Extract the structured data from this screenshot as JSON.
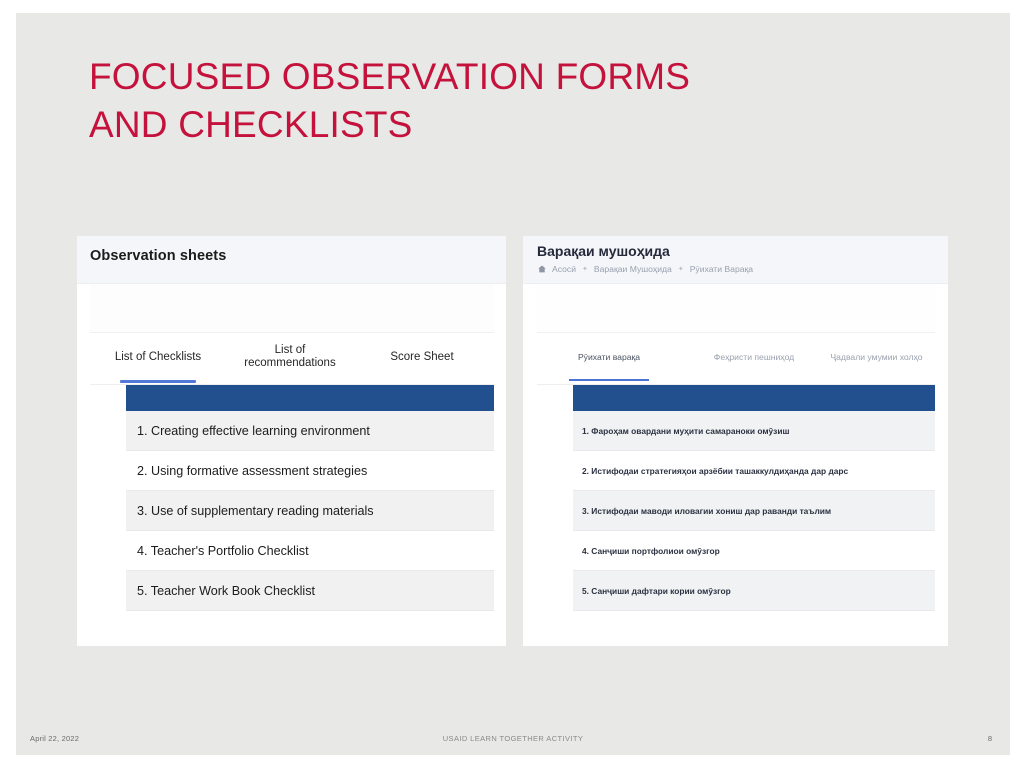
{
  "slide": {
    "title": "FOCUSED OBSERVATION FORMS\nAND CHECKLISTS",
    "title_color": "#c4123c",
    "background_color": "#e8e8e6"
  },
  "left_app": {
    "header_title": "Observation sheets",
    "tabs": [
      {
        "label": "List of Checklists",
        "active": true
      },
      {
        "label": "List of recommendations",
        "active": false
      },
      {
        "label": "Score Sheet",
        "active": false
      }
    ],
    "table_header_color": "#22508f",
    "rows": [
      "1. Creating effective learning environment",
      "2. Using formative assessment strategies",
      "3. Use of supplementary reading materials",
      "4. Teacher's Portfolio Checklist",
      "5. Teacher Work Book Checklist"
    ]
  },
  "right_app": {
    "header_title": "Варақаи мушоҳида",
    "breadcrumb": {
      "home_icon": "home-icon",
      "items": [
        "Асосӣ",
        "Варақаи Мушоҳида",
        "Рӯихати Варақа"
      ],
      "separator": "✦"
    },
    "tabs": [
      {
        "label": "Рӯихати варақа",
        "active": true
      },
      {
        "label": "Феҳристи пешниҳод",
        "active": false
      },
      {
        "label": "Ҷадвали умумии холҳо",
        "active": false
      }
    ],
    "table_header_color": "#22508f",
    "rows": [
      "1. Фароҳам овардани муҳити самараноки омӯзиш",
      "2. Истифодаи стратегияҳои арзёбии ташаккулдиҳанда дар дарс",
      "3. Истифодаи маводи иловагии хониш дар раванди таълим",
      "4. Санҷиши портфолиои омӯзгор",
      "5. Санҷиши дафтари кории омӯзгор"
    ]
  },
  "footer": {
    "date": "April 22, 2022",
    "center": "USAID LEARN TOGETHER ACTIVITY",
    "page": "8"
  }
}
